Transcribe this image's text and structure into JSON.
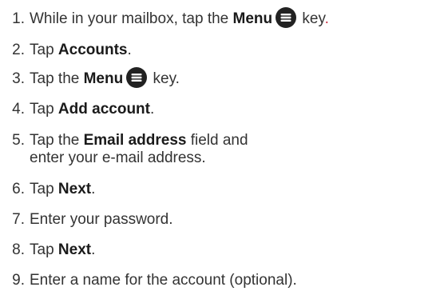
{
  "steps": [
    {
      "num": "1.",
      "pre": "While in your mailbox, tap the ",
      "bold": "Menu",
      "post": " key",
      "tail": "."
    },
    {
      "num": "2.",
      "pre": "Tap ",
      "bold": "Accounts",
      "post": "."
    },
    {
      "num": "3.",
      "pre": "Tap the ",
      "bold": "Menu",
      "post": " key."
    },
    {
      "num": "4.",
      "pre": "Tap ",
      "bold": "Add account",
      "post": "."
    },
    {
      "num": "5.",
      "pre": "Tap the ",
      "bold": "Email address",
      "post": " field and",
      "line2": "enter your e-mail address."
    },
    {
      "num": "6.",
      "pre": "Tap ",
      "bold": "Next",
      "post": "."
    },
    {
      "num": "7.",
      "pre": "Enter your password."
    },
    {
      "num": "8.",
      "pre": "Tap ",
      "bold": "Next",
      "post": "."
    },
    {
      "num": "9.",
      "pre": "Enter a name for the account (optional)."
    }
  ],
  "icons": {
    "menu": "menu-key-icon"
  },
  "colors": {
    "text": "#333333",
    "icon": "#222222",
    "accent_period": "#cc3344"
  }
}
